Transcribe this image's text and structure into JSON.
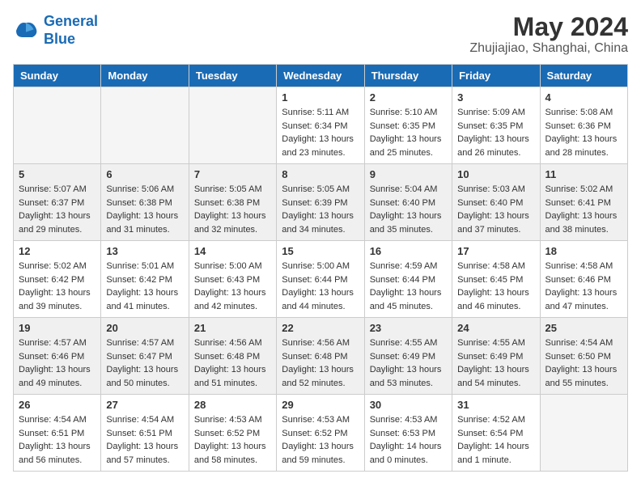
{
  "logo": {
    "text_general": "General",
    "text_blue": "Blue"
  },
  "title": "May 2024",
  "subtitle": "Zhujiajiao, Shanghai, China",
  "weekdays": [
    "Sunday",
    "Monday",
    "Tuesday",
    "Wednesday",
    "Thursday",
    "Friday",
    "Saturday"
  ],
  "weeks": [
    {
      "shaded": false,
      "days": [
        {
          "num": "",
          "info": ""
        },
        {
          "num": "",
          "info": ""
        },
        {
          "num": "",
          "info": ""
        },
        {
          "num": "1",
          "info": "Sunrise: 5:11 AM\nSunset: 6:34 PM\nDaylight: 13 hours\nand 23 minutes."
        },
        {
          "num": "2",
          "info": "Sunrise: 5:10 AM\nSunset: 6:35 PM\nDaylight: 13 hours\nand 25 minutes."
        },
        {
          "num": "3",
          "info": "Sunrise: 5:09 AM\nSunset: 6:35 PM\nDaylight: 13 hours\nand 26 minutes."
        },
        {
          "num": "4",
          "info": "Sunrise: 5:08 AM\nSunset: 6:36 PM\nDaylight: 13 hours\nand 28 minutes."
        }
      ]
    },
    {
      "shaded": true,
      "days": [
        {
          "num": "5",
          "info": "Sunrise: 5:07 AM\nSunset: 6:37 PM\nDaylight: 13 hours\nand 29 minutes."
        },
        {
          "num": "6",
          "info": "Sunrise: 5:06 AM\nSunset: 6:38 PM\nDaylight: 13 hours\nand 31 minutes."
        },
        {
          "num": "7",
          "info": "Sunrise: 5:05 AM\nSunset: 6:38 PM\nDaylight: 13 hours\nand 32 minutes."
        },
        {
          "num": "8",
          "info": "Sunrise: 5:05 AM\nSunset: 6:39 PM\nDaylight: 13 hours\nand 34 minutes."
        },
        {
          "num": "9",
          "info": "Sunrise: 5:04 AM\nSunset: 6:40 PM\nDaylight: 13 hours\nand 35 minutes."
        },
        {
          "num": "10",
          "info": "Sunrise: 5:03 AM\nSunset: 6:40 PM\nDaylight: 13 hours\nand 37 minutes."
        },
        {
          "num": "11",
          "info": "Sunrise: 5:02 AM\nSunset: 6:41 PM\nDaylight: 13 hours\nand 38 minutes."
        }
      ]
    },
    {
      "shaded": false,
      "days": [
        {
          "num": "12",
          "info": "Sunrise: 5:02 AM\nSunset: 6:42 PM\nDaylight: 13 hours\nand 39 minutes."
        },
        {
          "num": "13",
          "info": "Sunrise: 5:01 AM\nSunset: 6:42 PM\nDaylight: 13 hours\nand 41 minutes."
        },
        {
          "num": "14",
          "info": "Sunrise: 5:00 AM\nSunset: 6:43 PM\nDaylight: 13 hours\nand 42 minutes."
        },
        {
          "num": "15",
          "info": "Sunrise: 5:00 AM\nSunset: 6:44 PM\nDaylight: 13 hours\nand 44 minutes."
        },
        {
          "num": "16",
          "info": "Sunrise: 4:59 AM\nSunset: 6:44 PM\nDaylight: 13 hours\nand 45 minutes."
        },
        {
          "num": "17",
          "info": "Sunrise: 4:58 AM\nSunset: 6:45 PM\nDaylight: 13 hours\nand 46 minutes."
        },
        {
          "num": "18",
          "info": "Sunrise: 4:58 AM\nSunset: 6:46 PM\nDaylight: 13 hours\nand 47 minutes."
        }
      ]
    },
    {
      "shaded": true,
      "days": [
        {
          "num": "19",
          "info": "Sunrise: 4:57 AM\nSunset: 6:46 PM\nDaylight: 13 hours\nand 49 minutes."
        },
        {
          "num": "20",
          "info": "Sunrise: 4:57 AM\nSunset: 6:47 PM\nDaylight: 13 hours\nand 50 minutes."
        },
        {
          "num": "21",
          "info": "Sunrise: 4:56 AM\nSunset: 6:48 PM\nDaylight: 13 hours\nand 51 minutes."
        },
        {
          "num": "22",
          "info": "Sunrise: 4:56 AM\nSunset: 6:48 PM\nDaylight: 13 hours\nand 52 minutes."
        },
        {
          "num": "23",
          "info": "Sunrise: 4:55 AM\nSunset: 6:49 PM\nDaylight: 13 hours\nand 53 minutes."
        },
        {
          "num": "24",
          "info": "Sunrise: 4:55 AM\nSunset: 6:49 PM\nDaylight: 13 hours\nand 54 minutes."
        },
        {
          "num": "25",
          "info": "Sunrise: 4:54 AM\nSunset: 6:50 PM\nDaylight: 13 hours\nand 55 minutes."
        }
      ]
    },
    {
      "shaded": false,
      "days": [
        {
          "num": "26",
          "info": "Sunrise: 4:54 AM\nSunset: 6:51 PM\nDaylight: 13 hours\nand 56 minutes."
        },
        {
          "num": "27",
          "info": "Sunrise: 4:54 AM\nSunset: 6:51 PM\nDaylight: 13 hours\nand 57 minutes."
        },
        {
          "num": "28",
          "info": "Sunrise: 4:53 AM\nSunset: 6:52 PM\nDaylight: 13 hours\nand 58 minutes."
        },
        {
          "num": "29",
          "info": "Sunrise: 4:53 AM\nSunset: 6:52 PM\nDaylight: 13 hours\nand 59 minutes."
        },
        {
          "num": "30",
          "info": "Sunrise: 4:53 AM\nSunset: 6:53 PM\nDaylight: 14 hours\nand 0 minutes."
        },
        {
          "num": "31",
          "info": "Sunrise: 4:52 AM\nSunset: 6:54 PM\nDaylight: 14 hours\nand 1 minute."
        },
        {
          "num": "",
          "info": ""
        }
      ]
    }
  ]
}
